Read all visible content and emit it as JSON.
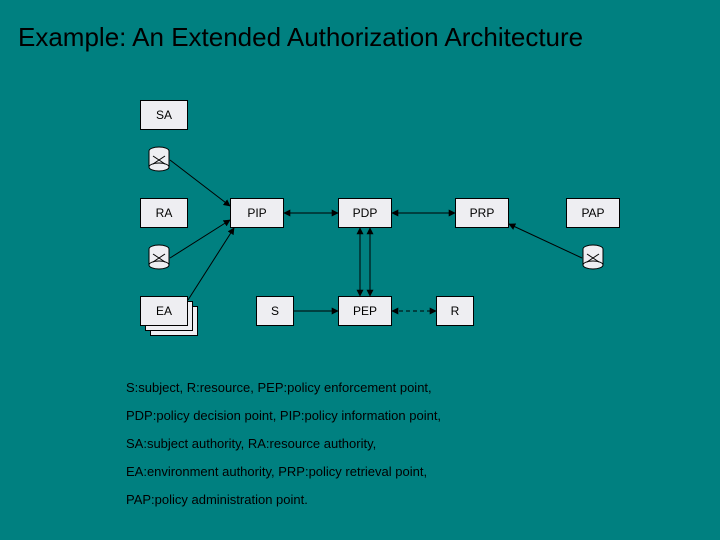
{
  "title": "Example: An Extended Authorization Architecture",
  "nodes": {
    "sa": {
      "label": "SA"
    },
    "ra": {
      "label": "RA"
    },
    "ea": {
      "label": "EA"
    },
    "pip": {
      "label": "PIP"
    },
    "pdp": {
      "label": "PDP"
    },
    "prp": {
      "label": "PRP"
    },
    "pap": {
      "label": "PAP"
    },
    "s": {
      "label": "S"
    },
    "pep": {
      "label": "PEP"
    },
    "r": {
      "label": "R"
    }
  },
  "legend": [
    "S:subject, R:resource, PEP:policy enforcement point,",
    "PDP:policy decision point, PIP:policy information point,",
    "SA:subject authority, RA:resource authority,",
    "EA:environment authority, PRP:policy retrieval point,",
    "PAP:policy administration point."
  ]
}
